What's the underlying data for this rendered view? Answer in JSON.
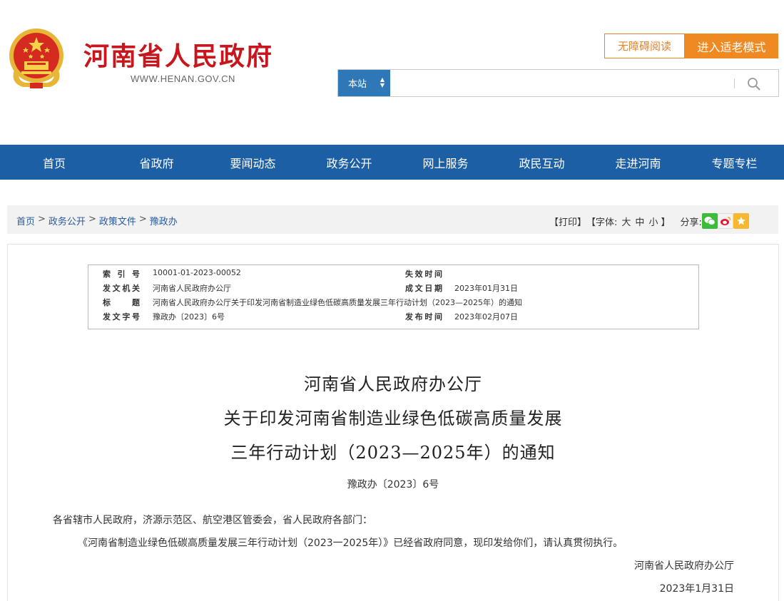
{
  "header": {
    "site_name": "河南省人民政府",
    "site_url": "WWW.HENAN.GOV.CN",
    "accessible_label": "无障碍阅读",
    "elder_mode_label": "进入适老模式",
    "search_scope": "本站",
    "search_placeholder": "",
    "accent_color": "#c8161d"
  },
  "nav": {
    "items": [
      "首页",
      "省政府",
      "要闻动态",
      "政务公开",
      "网上服务",
      "政民互动",
      "走进河南",
      "专题专栏"
    ],
    "background_color": "#1c5fa5"
  },
  "breadcrumb": [
    "首页",
    "政务公开",
    "政策文件",
    "豫政办"
  ],
  "tools": {
    "print": "【打印】",
    "font_label": "【字体:",
    "font_large": "大",
    "font_medium": "中",
    "font_small": "小",
    "font_close": "】",
    "share_label": "分享:",
    "share_icons": [
      "wechat-icon",
      "weibo-icon",
      "qzone-icon"
    ]
  },
  "meta": {
    "index_label": "索引号",
    "index_value": "10001-01-2023-00052",
    "expire_label": "失效时间",
    "expire_value": "",
    "issuer_label": "发文机关",
    "issuer_value": "河南省人民政府办公厅",
    "created_label": "成文日期",
    "created_value": "2023年01月31日",
    "title_label": "标　题",
    "title_value": "河南省人民政府办公厅关于印发河南省制造业绿色低碳高质量发展三年行动计划（2023—2025年）的通知",
    "docno_label": "发文字号",
    "docno_value": "豫政办〔2023〕6号",
    "published_label": "发布时间",
    "published_value": "2023年02月07日"
  },
  "document": {
    "title_line1": "河南省人民政府办公厅",
    "title_line2": "关于印发河南省制造业绿色低碳高质量发展",
    "title_line3": "三年行动计划（2023—2025年）的通知",
    "doc_number": "豫政办〔2023〕6号",
    "addressee": "各省辖市人民政府，济源示范区、航空港区管委会，省人民政府各部门：",
    "body": "《河南省制造业绿色低碳高质量发展三年行动计划（2023一2025年）》已经省政府同意，现印发给你们，请认真贯彻执行。",
    "sign_org": "河南省人民政府办公厅",
    "sign_date": "2023年1月31日"
  }
}
